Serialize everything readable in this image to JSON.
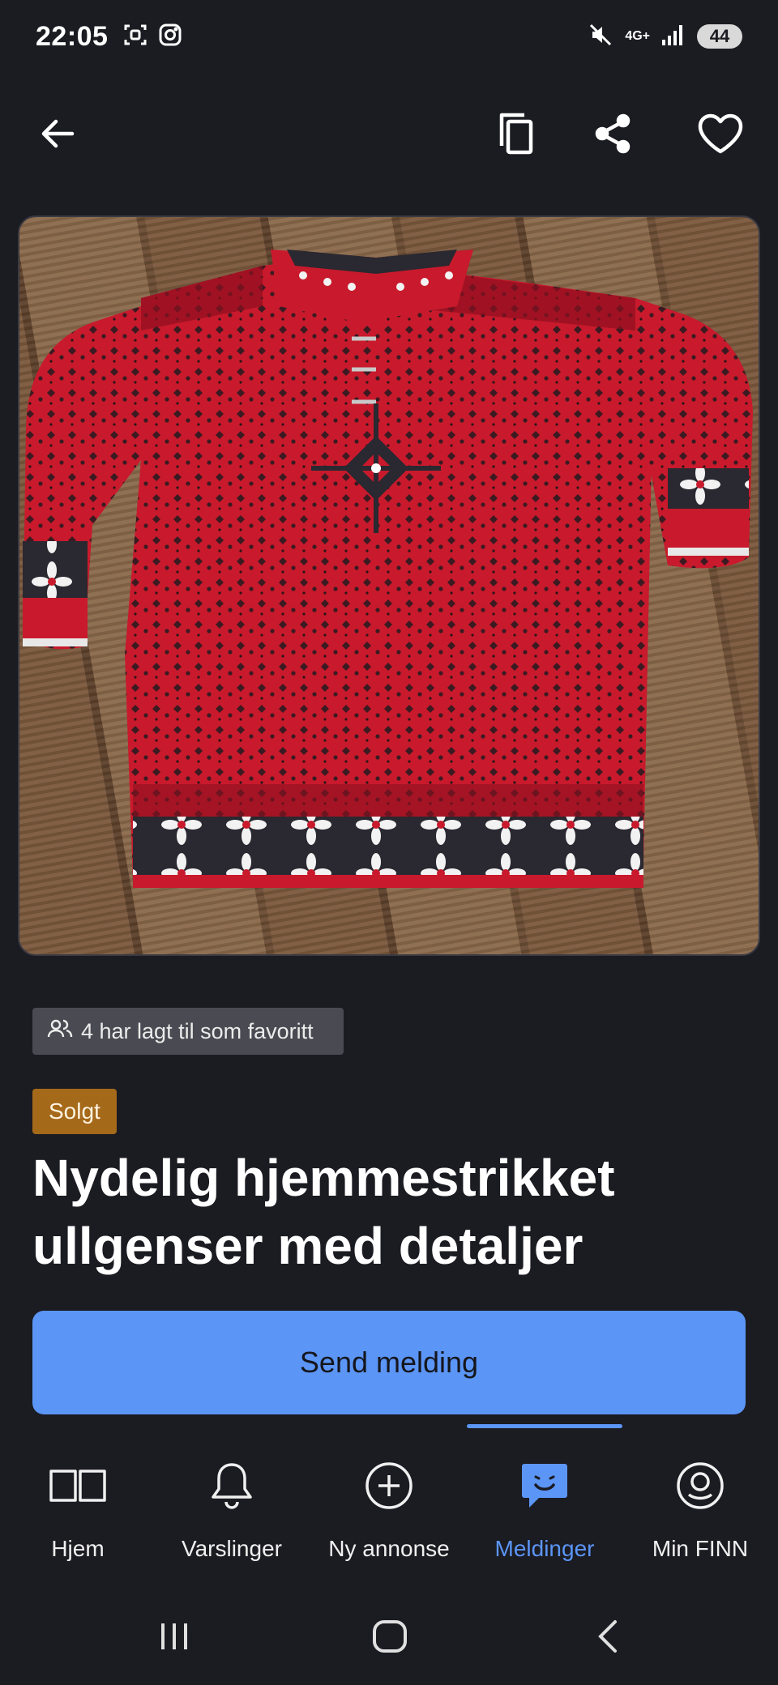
{
  "status_bar": {
    "time": "22:05",
    "network": "4G+",
    "battery": "44",
    "icons": [
      "screenshot-icon",
      "instagram-icon",
      "mute-icon",
      "signal-icon"
    ]
  },
  "top_bar": {
    "icons": [
      "back-arrow-icon",
      "copy-icon",
      "share-icon",
      "heart-icon"
    ]
  },
  "listing": {
    "image_alt": "",
    "favorites_text": "4 har lagt til som favoritt",
    "status_badge": "Solgt",
    "title_line1": "Nydelig hjemmestrikket",
    "title_line2": "ullgenser med detaljer",
    "send_button": "Send melding"
  },
  "bottom_nav": {
    "items": [
      {
        "label": "Hjem",
        "icon": "book-icon"
      },
      {
        "label": "Varslinger",
        "icon": "bell-icon"
      },
      {
        "label": "Ny annonse",
        "icon": "plus-circle-icon"
      },
      {
        "label": "Meldinger",
        "icon": "chat-icon"
      },
      {
        "label": "Min FINN",
        "icon": "profile-icon"
      }
    ],
    "active_index": 3
  },
  "colors": {
    "background": "#1b1b22",
    "accent": "#5b95f5",
    "sold": "#a5691a",
    "favorites_badge": "#4a4a52",
    "sweater_red": "#c81a2c"
  }
}
